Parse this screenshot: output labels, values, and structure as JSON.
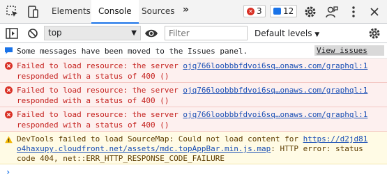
{
  "tabs": [
    {
      "label": "Elements"
    },
    {
      "label": "Console"
    },
    {
      "label": "Sources"
    }
  ],
  "more_tabs_glyph": "»",
  "badges": {
    "errors": "3",
    "issues": "12"
  },
  "toolbar": {
    "context": "top",
    "filter_placeholder": "Filter",
    "levels": "Default levels",
    "levels_caret": "▼",
    "context_caret": "▼"
  },
  "console": {
    "info": {
      "text": "Some messages have been moved to the Issues panel.",
      "link": "View issues"
    },
    "errors": [
      {
        "prefix": "Failed to load resource: the server ",
        "url": "ojq766loobbbfdvoi6sq…onaws.com/graphql:1",
        "line2": "responded with a status of 400 ()"
      },
      {
        "prefix": "Failed to load resource: the server ",
        "url": "ojq766loobbbfdvoi6sq…onaws.com/graphql:1",
        "line2": "responded with a status of 400 ()"
      },
      {
        "prefix": "Failed to load resource: the server ",
        "url": "ojq766loobbbfdvoi6sq…onaws.com/graphql:1",
        "line2": "responded with a status of 400 ()"
      }
    ],
    "warning": {
      "prefix": "DevTools failed to load SourceMap: Could not load content for ",
      "url1": "https://d2jd81",
      "url2": "o4haxupy.cloudfront.net/assets/mdc.topAppBar.min.js.map",
      "rest2": ": HTTP error: status",
      "line3": "code 404, net::ERR_HTTP_RESPONSE_CODE_FAILURE"
    },
    "prompt": "›"
  },
  "colors": {
    "accent": "#1a73e8",
    "error": "#d93025",
    "warning": "#f2b600"
  }
}
